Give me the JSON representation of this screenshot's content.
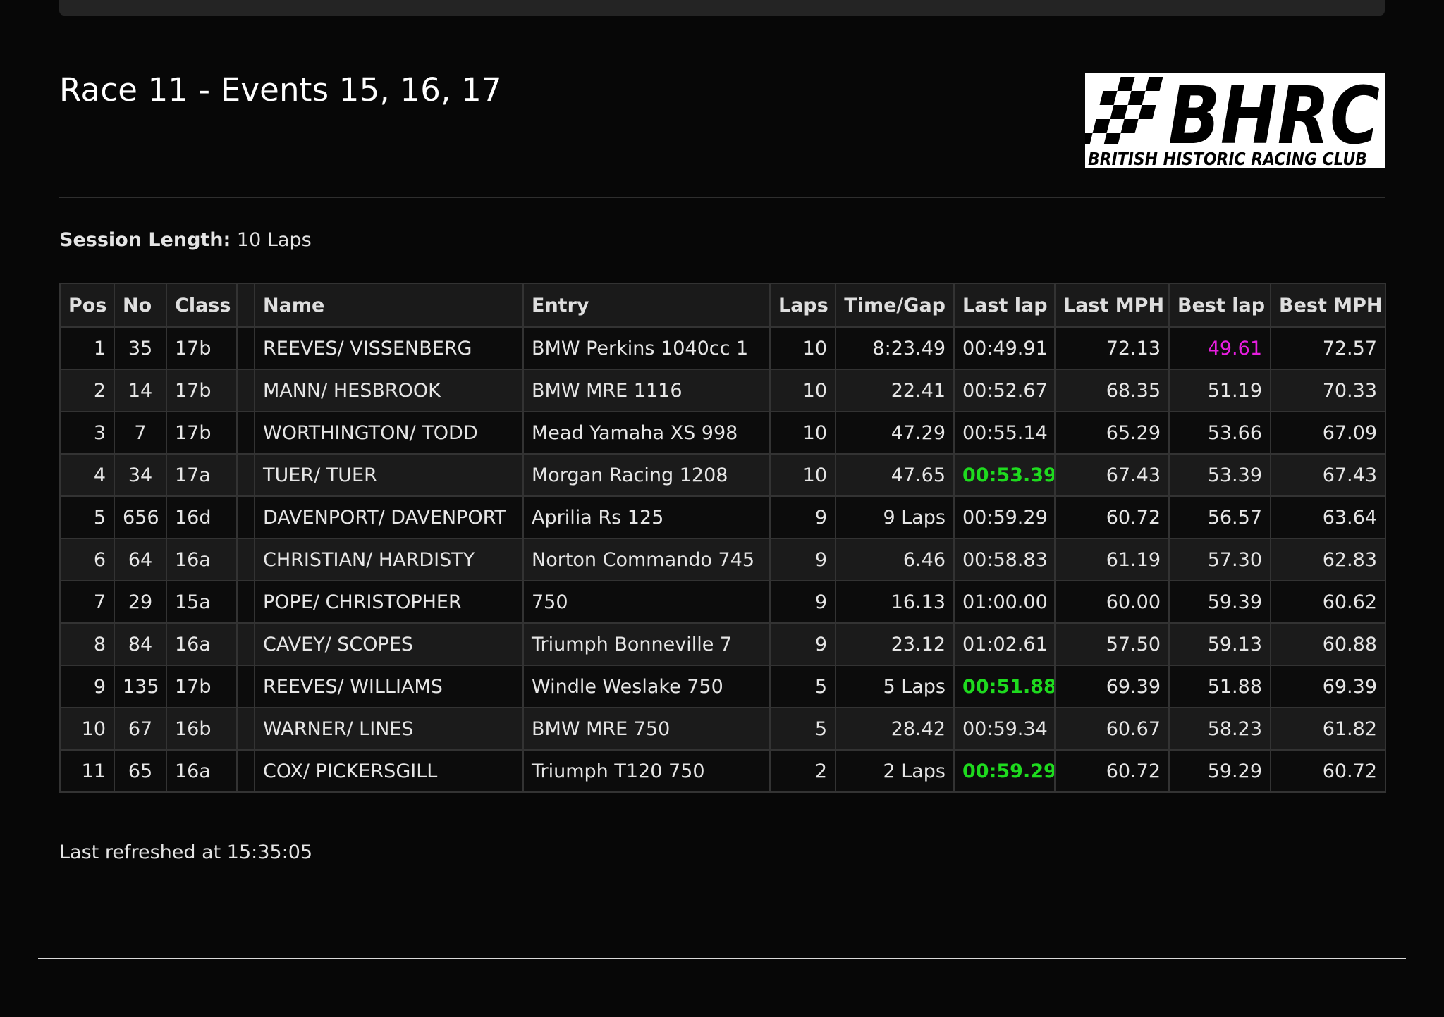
{
  "race": {
    "title": "Race 11 - Events 15, 16, 17"
  },
  "logo": {
    "brand": "BHRC",
    "subtitle": "BRITISH HISTORIC RACING CLUB"
  },
  "session": {
    "label": "Session Length:",
    "value": "10 Laps"
  },
  "colors": {
    "background": "#070707",
    "fastest_lap_green": "#1edb1e",
    "overall_best_purple": "#e81ee0"
  },
  "table": {
    "headers": {
      "pos": "Pos",
      "no": "No",
      "class": "Class",
      "flag": "",
      "name": "Name",
      "entry": "Entry",
      "laps": "Laps",
      "time_gap": "Time/Gap",
      "last_lap": "Last lap",
      "last_mph": "Last MPH",
      "best_lap": "Best lap",
      "best_mph": "Best MPH"
    },
    "rows": [
      {
        "pos": "1",
        "no": "35",
        "class": "17b",
        "name": "REEVES/ VISSENBERG",
        "entry": "BMW Perkins 1040cc 1",
        "laps": "10",
        "time_gap": "8:23.49",
        "last_lap": "00:49.91",
        "last_mph": "72.13",
        "best_lap": "49.61",
        "best_mph": "72.57",
        "last_lap_highlight": "",
        "best_lap_highlight": "purple"
      },
      {
        "pos": "2",
        "no": "14",
        "class": "17b",
        "name": "MANN/ HESBROOK",
        "entry": "BMW MRE 1116",
        "laps": "10",
        "time_gap": "22.41",
        "last_lap": "00:52.67",
        "last_mph": "68.35",
        "best_lap": "51.19",
        "best_mph": "70.33",
        "last_lap_highlight": "",
        "best_lap_highlight": ""
      },
      {
        "pos": "3",
        "no": "7",
        "class": "17b",
        "name": "WORTHINGTON/ TODD",
        "entry": "Mead Yamaha XS 998",
        "laps": "10",
        "time_gap": "47.29",
        "last_lap": "00:55.14",
        "last_mph": "65.29",
        "best_lap": "53.66",
        "best_mph": "67.09",
        "last_lap_highlight": "",
        "best_lap_highlight": ""
      },
      {
        "pos": "4",
        "no": "34",
        "class": "17a",
        "name": "TUER/ TUER",
        "entry": "Morgan Racing 1208",
        "laps": "10",
        "time_gap": "47.65",
        "last_lap": "00:53.39",
        "last_mph": "67.43",
        "best_lap": "53.39",
        "best_mph": "67.43",
        "last_lap_highlight": "green",
        "best_lap_highlight": ""
      },
      {
        "pos": "5",
        "no": "656",
        "class": "16d",
        "name": "DAVENPORT/ DAVENPORT",
        "entry": "Aprilia Rs 125",
        "laps": "9",
        "time_gap": "9 Laps",
        "last_lap": "00:59.29",
        "last_mph": "60.72",
        "best_lap": "56.57",
        "best_mph": "63.64",
        "last_lap_highlight": "",
        "best_lap_highlight": ""
      },
      {
        "pos": "6",
        "no": "64",
        "class": "16a",
        "name": "CHRISTIAN/ HARDISTY",
        "entry": "Norton Commando 745",
        "laps": "9",
        "time_gap": "6.46",
        "last_lap": "00:58.83",
        "last_mph": "61.19",
        "best_lap": "57.30",
        "best_mph": "62.83",
        "last_lap_highlight": "",
        "best_lap_highlight": ""
      },
      {
        "pos": "7",
        "no": "29",
        "class": "15a",
        "name": "POPE/ CHRISTOPHER",
        "entry": "750",
        "laps": "9",
        "time_gap": "16.13",
        "last_lap": "01:00.00",
        "last_mph": "60.00",
        "best_lap": "59.39",
        "best_mph": "60.62",
        "last_lap_highlight": "",
        "best_lap_highlight": ""
      },
      {
        "pos": "8",
        "no": "84",
        "class": "16a",
        "name": "CAVEY/ SCOPES",
        "entry": "Triumph Bonneville 7",
        "laps": "9",
        "time_gap": "23.12",
        "last_lap": "01:02.61",
        "last_mph": "57.50",
        "best_lap": "59.13",
        "best_mph": "60.88",
        "last_lap_highlight": "",
        "best_lap_highlight": ""
      },
      {
        "pos": "9",
        "no": "135",
        "class": "17b",
        "name": "REEVES/ WILLIAMS",
        "entry": "Windle Weslake 750",
        "laps": "5",
        "time_gap": "5 Laps",
        "last_lap": "00:51.88",
        "last_mph": "69.39",
        "best_lap": "51.88",
        "best_mph": "69.39",
        "last_lap_highlight": "green",
        "best_lap_highlight": ""
      },
      {
        "pos": "10",
        "no": "67",
        "class": "16b",
        "name": "WARNER/ LINES",
        "entry": "BMW MRE 750",
        "laps": "5",
        "time_gap": "28.42",
        "last_lap": "00:59.34",
        "last_mph": "60.67",
        "best_lap": "58.23",
        "best_mph": "61.82",
        "last_lap_highlight": "",
        "best_lap_highlight": ""
      },
      {
        "pos": "11",
        "no": "65",
        "class": "16a",
        "name": "COX/ PICKERSGILL",
        "entry": "Triumph T120 750",
        "laps": "2",
        "time_gap": "2 Laps",
        "last_lap": "00:59.29",
        "last_mph": "60.72",
        "best_lap": "59.29",
        "best_mph": "60.72",
        "last_lap_highlight": "green",
        "best_lap_highlight": ""
      }
    ]
  },
  "footer": {
    "refreshed_text": "Last refreshed at 15:35:05"
  }
}
